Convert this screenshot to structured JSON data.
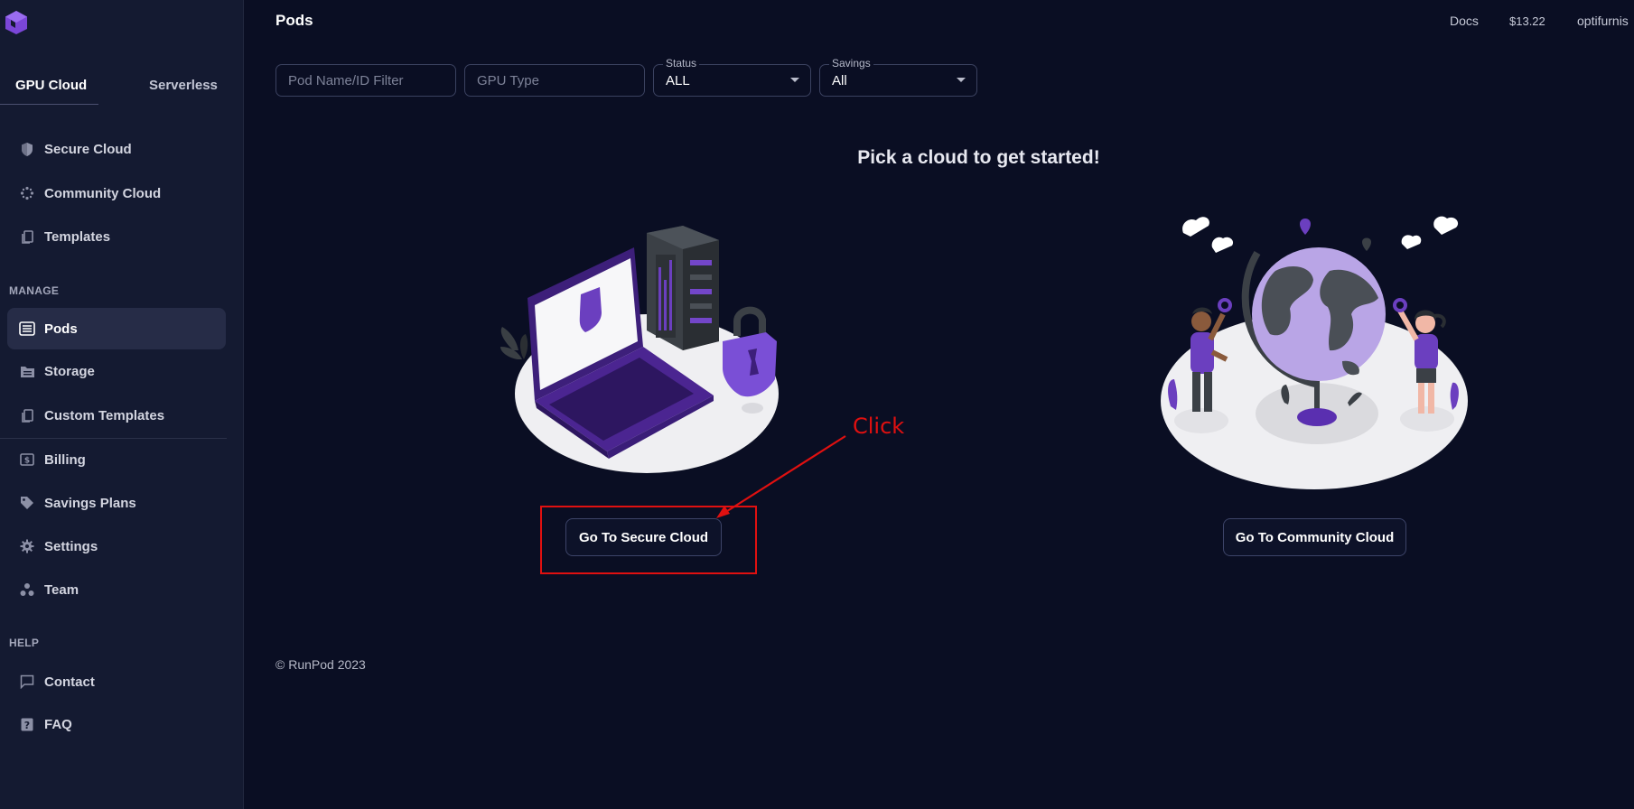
{
  "sidebar": {
    "tabs": [
      {
        "label": "GPU Cloud"
      },
      {
        "label": "Serverless"
      }
    ],
    "top_items": [
      {
        "label": "Secure Cloud",
        "icon": "shield-icon"
      },
      {
        "label": "Community Cloud",
        "icon": "community-icon"
      },
      {
        "label": "Templates",
        "icon": "copy-icon"
      }
    ],
    "manage_label": "MANAGE",
    "manage_items": [
      {
        "label": "Pods",
        "icon": "list-icon",
        "active": true
      },
      {
        "label": "Storage",
        "icon": "folder-icon"
      },
      {
        "label": "Custom Templates",
        "icon": "copy-icon"
      },
      {
        "label": "Billing",
        "icon": "dollar-icon"
      },
      {
        "label": "Savings Plans",
        "icon": "tag-icon"
      },
      {
        "label": "Settings",
        "icon": "gear-icon"
      },
      {
        "label": "Team",
        "icon": "team-icon"
      }
    ],
    "help_label": "HELP",
    "help_items": [
      {
        "label": "Contact",
        "icon": "chat-icon"
      },
      {
        "label": "FAQ",
        "icon": "question-icon"
      }
    ]
  },
  "header": {
    "title": "Pods",
    "docs": "Docs",
    "balance": "$13.22",
    "user": "optifurnis"
  },
  "filters": {
    "pod_name_placeholder": "Pod Name/ID Filter",
    "gpu_type_placeholder": "GPU Type",
    "status_label": "Status",
    "status_value": "ALL",
    "savings_label": "Savings",
    "savings_value": "All"
  },
  "main": {
    "headline": "Pick a cloud to get started!",
    "secure_button": "Go To Secure Cloud",
    "community_button": "Go To Community Cloud"
  },
  "footer": "© RunPod 2023",
  "annotation": {
    "text": "Click",
    "color": "#e01010"
  },
  "colors": {
    "background": "#0a0e23",
    "sidebar": "#141a31",
    "accent": "#6b3fbf"
  }
}
